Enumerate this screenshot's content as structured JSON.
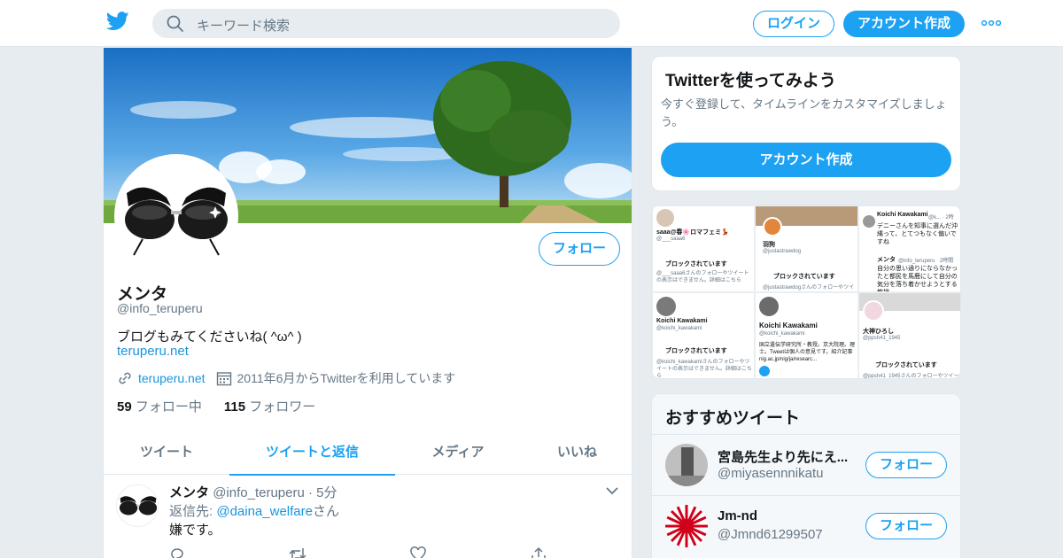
{
  "header": {
    "logo_icon": "twitter-bird-icon",
    "search_placeholder": "キーワード検索",
    "login_label": "ログイン",
    "signup_label": "アカウント作成",
    "more_icon": "more-dots-icon"
  },
  "profile": {
    "name": "メンタ",
    "handle": "@info_teruperu",
    "bio": "ブログもみてくださいね( ^ω^ )",
    "bio_link": "teruperu.net",
    "website": "teruperu.net",
    "joined": "2011年6月からTwitterを利用しています",
    "following_count": "59",
    "following_label": "フォロー中",
    "followers_count": "115",
    "followers_label": "フォロワー",
    "follow_button": "フォロー"
  },
  "tabs": [
    {
      "label": "ツイート",
      "active": false
    },
    {
      "label": "ツイートと返信",
      "active": true
    },
    {
      "label": "メディア",
      "active": false
    },
    {
      "label": "いいね",
      "active": false
    }
  ],
  "tweet": {
    "name": "メンタ",
    "handle": "@info_teruperu",
    "time": "5分",
    "reply_prefix": "返信先: ",
    "reply_user": "@daina_welfare",
    "reply_suffix": "さん",
    "text": "嫌です。"
  },
  "signup_card": {
    "title": "Twitterを使ってみよう",
    "subtitle": "今すぐ登録して、タイムラインをカスタマイズしましょう。",
    "button": "アカウント作成"
  },
  "media_grid": {
    "cells": [
      {
        "name": "saaa@春🌸ロマフェミ💃",
        "handle": "@___saaa6",
        "blocked": "ブロックされています",
        "desc": "@___saaa6さんのフォローやツイートの表示はできません。詳細はこちら"
      },
      {
        "name": "羽狗",
        "handle": "@justastrawdog",
        "blocked": "ブロックされています",
        "desc": "@justastrawdogさんのフォローやツイ"
      },
      {
        "name": "Koichi Kawakami",
        "handle": "@k... · 2時",
        "blocked": "",
        "desc": "デニーさんを知事に選んだ沖縄って、とてつもなく偏いですね"
      },
      {
        "name": "Koichi Kawakami",
        "handle": "@koichi_kawakami",
        "blocked": "ブロックされています",
        "desc": "@koichi_kawakamiさんのフォローやツイートの表示はできません。詳細はこちら"
      },
      {
        "name": "Koichi Kawakami",
        "handle": "@koichi_kawakami",
        "blocked": "",
        "desc": "国立遺伝学研究所・教授。京大院理。理士。Tweetは個人の意見です。紹介記事 nig.ac.jp/nig/ja/researc..."
      },
      {
        "name": "大神ひろし",
        "handle": "@ppsh41_1945",
        "blocked": "ブロックされています",
        "desc": "@ppsh41_1945さんのフォローやツイー"
      },
      {
        "name": "メンタ",
        "handle": "@info_teruperu · 2時間",
        "blocked": "",
        "desc": "自分の思い通りにならなかったと都民を馬鹿にして自分の気分を落ち着かせようとする教授"
      }
    ]
  },
  "recommended": {
    "title": "おすすめツイート",
    "items": [
      {
        "name": "宮島先生より先にえ...",
        "handle": "@miyasennnikatu",
        "button": "フォロー"
      },
      {
        "name": "Jm-nd",
        "handle": "@Jmnd61299507",
        "button": "フォロー"
      }
    ]
  },
  "colors": {
    "accent": "#1da1f2",
    "link": "#1b95e0",
    "background": "#e6ecf0",
    "muted": "#657786"
  }
}
